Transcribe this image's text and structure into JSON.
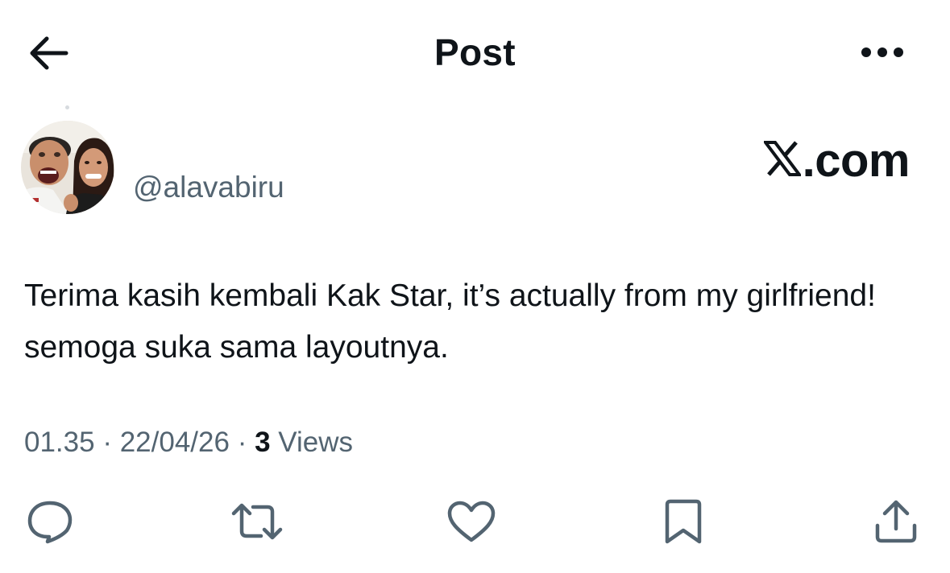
{
  "header": {
    "title": "Post",
    "back_icon": "arrow-left-icon",
    "more_icon": "ellipsis-icon"
  },
  "author": {
    "handle": "@alavabiru",
    "avatar": "profile-photo"
  },
  "watermark": {
    "text": ".com",
    "logo": "x-logo-icon"
  },
  "post": {
    "text": "Terima kasih kembali Kak Star, it’s actually from my girlfriend! semoga suka sama layoutnya."
  },
  "meta": {
    "time": "01.35",
    "separator": "·",
    "date": "22/04/26",
    "views_count": "3",
    "views_label": "Views"
  },
  "actions": [
    {
      "name": "reply",
      "icon": "reply-icon"
    },
    {
      "name": "repost",
      "icon": "repost-icon"
    },
    {
      "name": "like",
      "icon": "heart-icon"
    },
    {
      "name": "bookmark",
      "icon": "bookmark-icon"
    },
    {
      "name": "share",
      "icon": "share-icon"
    }
  ],
  "colors": {
    "text": "#0f1419",
    "secondary": "#536471"
  }
}
